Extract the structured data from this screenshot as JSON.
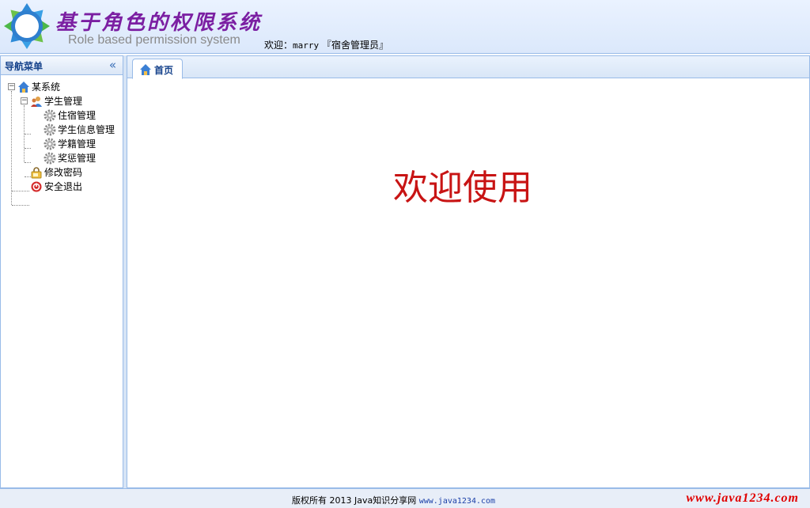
{
  "header": {
    "title_cn": "基于角色的权限系统",
    "title_en": "Role based permission system",
    "welcome_prefix": "欢迎：",
    "username": "marry",
    "role": "『宿舍管理员』"
  },
  "nav": {
    "title": "导航菜单",
    "collapse_glyph": "«",
    "toggle_glyph": "−",
    "root": "某系统",
    "group": "学生管理",
    "items": [
      "住宿管理",
      "学生信息管理",
      "学籍管理",
      "奖惩管理"
    ],
    "change_password": "修改密码",
    "logout": "安全退出"
  },
  "tabs": [
    {
      "label": "首页"
    }
  ],
  "main": {
    "welcome_text": "欢迎使用"
  },
  "footer": {
    "copyright_text": "版权所有 2013 Java知识分享网 ",
    "link_text": "www.java1234.com",
    "watermark": "www.java1234.com"
  },
  "colors": {
    "title": "#7b1fa2",
    "accent_border": "#99bbe8",
    "welcome_red": "#c81414",
    "watermark_red": "#e00000"
  }
}
